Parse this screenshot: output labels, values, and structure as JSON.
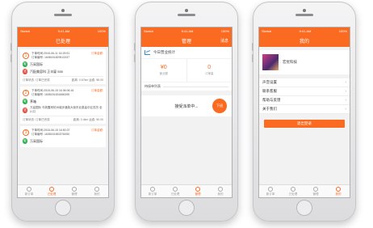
{
  "colors": {
    "accent": "#fb6a21"
  },
  "status": {
    "carrier": "Sketch",
    "time": "9:41 AM",
    "battery": "100%"
  },
  "phone1": {
    "title": "已处理",
    "orders": [
      {
        "num": "1",
        "time": "下单时间:2018-06-11 16:29:51",
        "order_no": "订单编号: 1608151829513337",
        "badge": "订单金额:",
        "from": "万采国际",
        "to": "汽配美容科 正丰厦 555",
        "meta_left": "订单状态: 订单已完成",
        "meta_right": "距离: 0.67km 运费: ¥8.00"
      },
      {
        "num": "2",
        "time": "下单时间:2018-06-15 16:36:06:16",
        "order_no": "订单编号: 1608151631666395",
        "badge": "订单金额:",
        "from": "茅箱",
        "to": "万高国际 乌鲁醒来杭州城步通英大街东北泉高中区农历 全川口",
        "meta_left": "订单状态: 订单已完成",
        "meta_right": "距离: 0.4km 运费: ¥0.00"
      },
      {
        "num": "3",
        "time": "下单时间:2018-06-15 16:50:37",
        "order_no": "订单编号: 1608151652376050",
        "badge": "订单金额:",
        "from": "万采国际",
        "to": "",
        "meta_left": "",
        "meta_right": ""
      }
    ]
  },
  "phone2": {
    "title": "管理",
    "right": "消息",
    "today": "今日营业统计",
    "stats": [
      {
        "value": "¥0",
        "label": "营业额"
      },
      {
        "value": "0",
        "label": "订单量"
      }
    ],
    "pending": "待接单列表",
    "taking": "接受派单中...",
    "take_btn": "下班"
  },
  "phone3": {
    "title": "我的",
    "name": "宏优科技",
    "menu": [
      "声音设置",
      "联系客服",
      "帮助与反馈",
      "关于我们"
    ],
    "logout": "退出登录"
  },
  "tabs": [
    "新订单",
    "已处理",
    "管理",
    "我的"
  ]
}
